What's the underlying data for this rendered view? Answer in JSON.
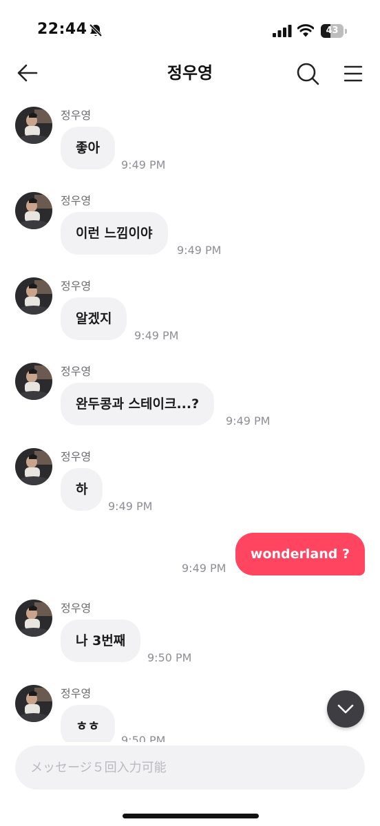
{
  "status_bar": {
    "time": "22:44",
    "battery": "43",
    "battery_level": 0.43
  },
  "header": {
    "title": "정우영"
  },
  "messages": [
    {
      "sender": "정우영",
      "text": "좋아",
      "time": "9:49 PM"
    },
    {
      "sender": "정우영",
      "text": "이런 느낌이야",
      "time": "9:49 PM"
    },
    {
      "sender": "정우영",
      "text": "알겠지",
      "time": "9:49 PM"
    },
    {
      "sender": "정우영",
      "text": "완두콩과 스테이크...?",
      "time": "9:49 PM"
    },
    {
      "sender": "정우영",
      "text": "하",
      "time": "9:49 PM"
    },
    {
      "text": "wonderland ?",
      "time": "9:49 PM"
    },
    {
      "sender": "정우영",
      "text": "나 3번째",
      "time": "9:50 PM"
    },
    {
      "sender": "정우영",
      "text": "ㅎㅎ",
      "time": "9:50 PM"
    }
  ],
  "input": {
    "placeholder": "メッセージ５回入力可能"
  },
  "colors": {
    "outgoing_bubble": "#ff4560",
    "incoming_bubble": "#f2f2f5",
    "scroll_button": "#3e3e42"
  },
  "icons": {
    "back": "arrow-left-icon",
    "search": "search-icon",
    "menu": "hamburger-menu-icon",
    "scroll_down": "chevron-down-icon",
    "mute": "bell-slash-icon",
    "signal": "cellular-signal-icon",
    "wifi": "wifi-icon"
  }
}
